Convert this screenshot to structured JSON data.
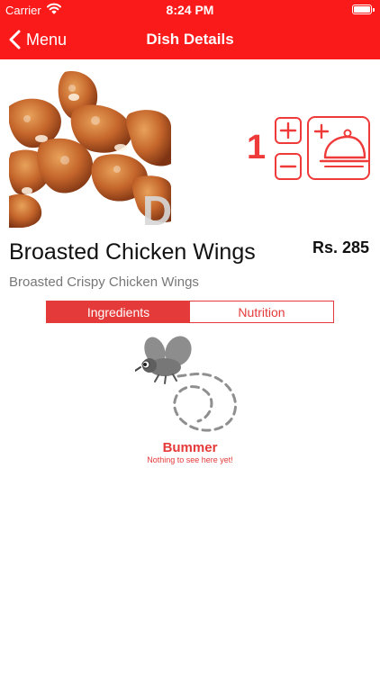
{
  "status_bar": {
    "carrier": "Carrier",
    "time": "8:24 PM"
  },
  "nav": {
    "back_label": "Menu",
    "title": "Dish Details"
  },
  "dish": {
    "name": "Broasted Chicken Wings",
    "price": "Rs. 285",
    "description": "Broasted Crispy Chicken Wings",
    "image_watermark": "D"
  },
  "order": {
    "quantity": "1"
  },
  "tabs": [
    {
      "label": "Ingredients",
      "active": true
    },
    {
      "label": "Nutrition",
      "active": false
    }
  ],
  "empty_state": {
    "title": "Bummer",
    "subtitle": "Nothing to see here yet!"
  },
  "colors": {
    "header": "#fb1a1a",
    "accent": "#e53a3a",
    "text_muted": "#777777"
  },
  "icons": {
    "back": "chevron-left-icon",
    "wifi": "wifi-icon",
    "battery": "battery-icon",
    "plus": "plus-icon",
    "minus": "minus-icon",
    "add_to_cart": "serving-cloche-icon",
    "empty": "fly-icon"
  }
}
